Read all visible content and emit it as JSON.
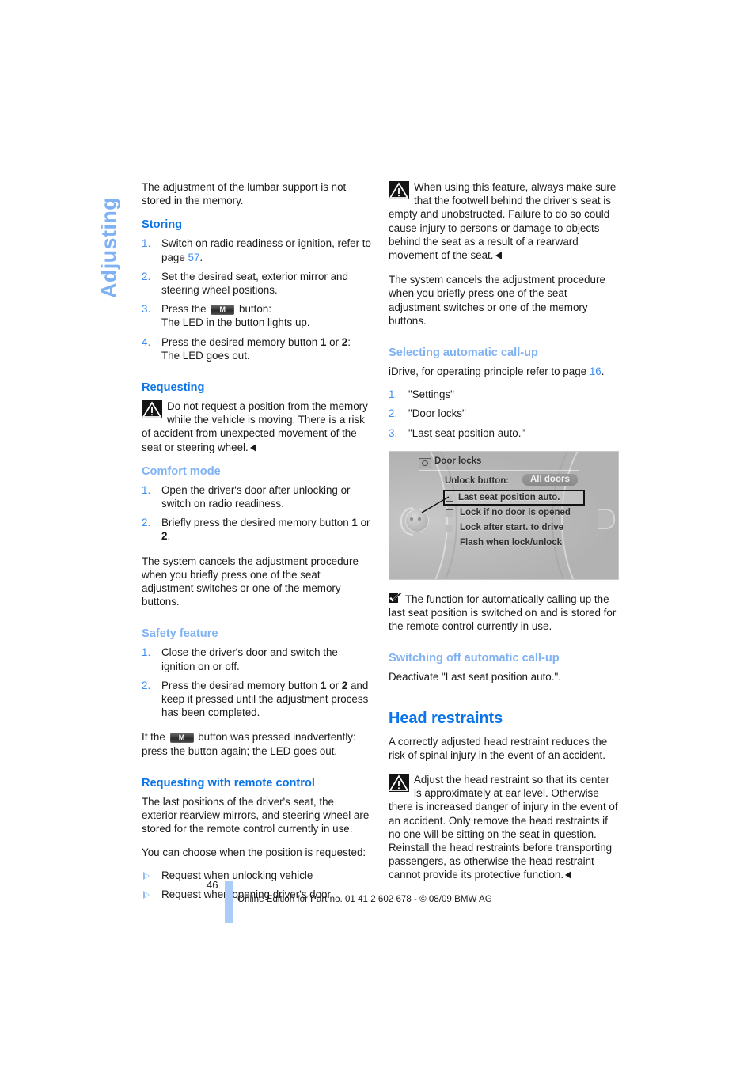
{
  "chapter": {
    "label": "Adjusting"
  },
  "left_column": {
    "intro": "The adjustment of the lumbar support is not stored in the memory.",
    "storing": {
      "heading": "Storing",
      "steps": [
        {
          "num": "1.",
          "pre": "Switch on radio readiness or ignition, refer to page ",
          "xref": "57",
          "post": "."
        },
        {
          "num": "2.",
          "pre": "Set the desired seat, exterior mirror and steering wheel positions.",
          "xref": "",
          "post": ""
        },
        {
          "num": "3.",
          "pre": "Press the ",
          "icon": "M",
          "post": " button:\nThe LED in the button lights up."
        },
        {
          "num": "4.",
          "pre": "Press the desired memory button ",
          "b1": "1",
          "mid": " or ",
          "b2": "2",
          "post": ":\nThe LED goes out."
        }
      ]
    },
    "requesting": {
      "heading": "Requesting",
      "warning": "Do not request a position from the memory while the vehicle is moving. There is a risk of accident from unexpected movement of the seat or steering wheel."
    },
    "comfort_mode": {
      "heading": "Comfort mode",
      "steps": [
        {
          "num": "1.",
          "text": "Open the driver's door after unlocking or switch on radio readiness."
        },
        {
          "num": "2.",
          "pre": "Briefly press the desired memory button ",
          "b1": "1",
          "mid": " or ",
          "b2": "2",
          "post": "."
        }
      ],
      "note": "The system cancels the adjustment procedure when you briefly press one of the seat adjustment switches or one of the memory buttons."
    },
    "safety_feature": {
      "heading": "Safety feature",
      "steps": [
        {
          "num": "1.",
          "text": "Close the driver's door and switch the ignition on or off."
        },
        {
          "num": "2.",
          "pre": "Press the desired memory button ",
          "b1": "1",
          "mid": " or ",
          "b2": "2",
          "post": " and keep it pressed until the adjustment process has been completed."
        }
      ],
      "note_pre": "If the ",
      "note_icon": "M",
      "note_post": " button was pressed inadvertently: press the button again; the LED goes out."
    },
    "remote_control": {
      "heading": "Requesting with remote control",
      "para1": "The last positions of the driver's seat, the exterior rearview mirrors, and steering wheel are stored for the remote control currently in use.",
      "para2": "You can choose when the position is requested:",
      "bullets": [
        "Request when unlocking vehicle",
        "Request when opening driver's door"
      ]
    }
  },
  "right_column": {
    "warning_footwell": "When using this feature, always make sure that the footwell behind the driver's seat is empty and unobstructed. Failure to do so could cause injury to persons or damage to objects behind the seat as a result of a rearward movement of the seat.",
    "cancel_note": "The system cancels the adjustment procedure when you briefly press one of the seat adjustment switches or one of the memory buttons.",
    "selecting": {
      "heading": "Selecting automatic call-up",
      "intro_pre": "iDrive, for operating principle refer to page ",
      "intro_xref": "16",
      "intro_post": ".",
      "steps": [
        {
          "num": "1.",
          "text": "\"Settings\""
        },
        {
          "num": "2.",
          "text": "\"Door locks\""
        },
        {
          "num": "3.",
          "text": "\"Last seat position auto.\""
        }
      ]
    },
    "idrive_screen": {
      "title": "Door locks",
      "unlock_label": "Unlock button:",
      "unlock_value": "All doors",
      "items": [
        {
          "label": "Last seat position auto.",
          "checked": false,
          "selected": true
        },
        {
          "label": "Lock if no door is opened",
          "checked": false,
          "selected": false
        },
        {
          "label": "Lock after start. to drive",
          "checked": false,
          "selected": false
        },
        {
          "label": "Flash when lock/unlock",
          "checked": false,
          "selected": false
        }
      ]
    },
    "check_note": "The function for automatically calling up the last seat position is switched on and is stored for the remote control currently in use.",
    "switching_off": {
      "heading": "Switching off automatic call-up",
      "text": "Deactivate \"Last seat position auto.\"."
    },
    "head_restraints": {
      "heading": "Head restraints",
      "intro": "A correctly adjusted head restraint reduces the risk of spinal injury in the event of an accident.",
      "warning": "Adjust the head restraint so that its center is approximately at ear level. Otherwise there is increased danger of injury in the event of an accident. Only remove the head restraints if no one will be sitting on the seat in question. Reinstall the head restraints before transporting passengers, as otherwise the head restraint cannot provide its protective function."
    }
  },
  "footer": {
    "page_number": "46",
    "text": "Online Edition for Part no. 01 41 2 602 678 - © 08/09 BMW AG"
  },
  "colors": {
    "heading_strong": "#0a74e8",
    "heading_light": "#7fb2f5",
    "xref": "#3d8ef0",
    "footer_bar": "#aaccf6"
  }
}
